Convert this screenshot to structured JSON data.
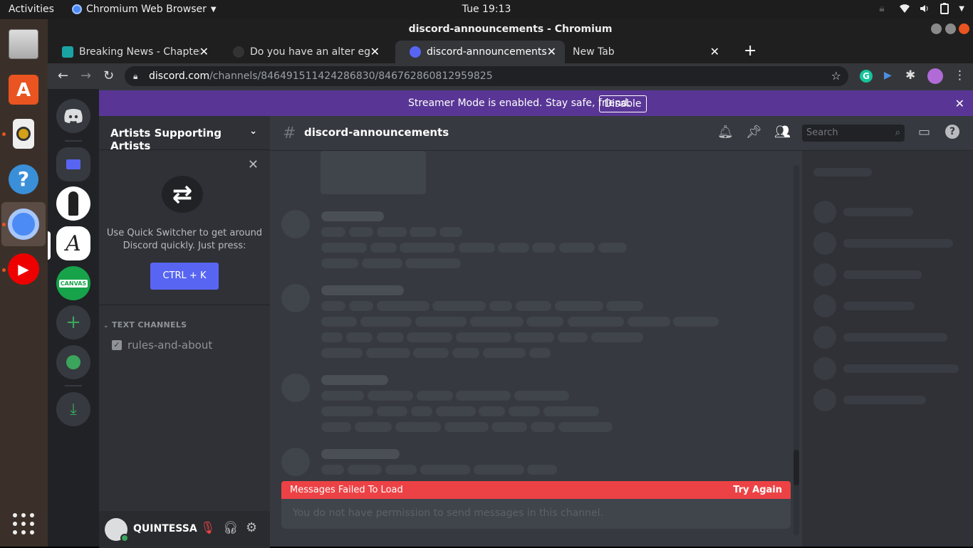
{
  "topbar": {
    "activities": "Activities",
    "app_name": "Chromium Web Browser",
    "clock": "Tue 19:13"
  },
  "window": {
    "title": "discord-announcements - Chromium"
  },
  "tabs": [
    {
      "label": "Breaking News - Chapter",
      "favicon_color": "#1aa3a3",
      "active": false
    },
    {
      "label": "Do you have an alter ego w",
      "favicon_color": "#333333",
      "active": false
    },
    {
      "label": "discord-announcements",
      "favicon_color": "#5865f2",
      "active": true
    },
    {
      "label": "New Tab",
      "favicon_color": "",
      "active": false
    }
  ],
  "omnibox": {
    "host": "discord.com",
    "path": "/channels/846491511424286830/846762860812959825"
  },
  "streamer": {
    "message": "Streamer Mode is enabled. Stay safe, friend.",
    "button": "Disable"
  },
  "server": {
    "name": "Artists Supporting Artists",
    "quick_switcher_text": "Use Quick Switcher to get around Discord quickly. Just press:",
    "quick_switcher_key": "CTRL + K",
    "category": "TEXT CHANNELS",
    "channel": "rules-and-about"
  },
  "user": {
    "name": "QUINTESSA"
  },
  "chat": {
    "channel_name": "discord-announcements",
    "search_placeholder": "Search",
    "error_text": "Messages Failed To Load",
    "retry": "Try Again",
    "composer_text": "You do not have permission to send messages in this channel."
  },
  "colors": {
    "blurple": "#5865f2",
    "streamer_bar": "#593695",
    "error": "#ed4245",
    "green": "#3ba55d"
  }
}
